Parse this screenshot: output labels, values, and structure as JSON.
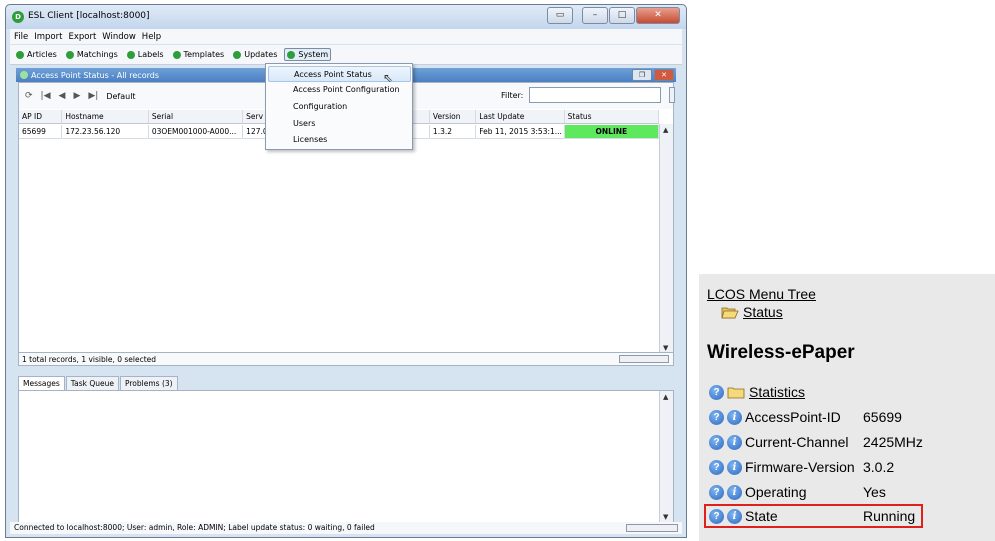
{
  "window": {
    "title": "ESL Client [localhost:8000]"
  },
  "menubar": [
    "File",
    "Import",
    "Export",
    "Window",
    "Help"
  ],
  "toolbar": {
    "items": [
      "Articles",
      "Matchings",
      "Labels",
      "Templates",
      "Updates",
      "System"
    ]
  },
  "inner_frame": {
    "title": "Access Point Status - All records"
  },
  "panel_toolbar": {
    "default_label": "Default",
    "filter_label": "Filter:",
    "filter_value": ""
  },
  "table": {
    "headers": [
      "AP ID",
      "Hostname",
      "Serial",
      "Serv",
      "o...",
      "Version",
      "Last Update",
      "Status"
    ],
    "rows": [
      [
        "65699",
        "172.23.56.120",
        "03OEM001000-A000...",
        "127.0",
        "",
        "1.3.2",
        "Feb 11, 2015 3:53:1...",
        "ONLINE"
      ]
    ]
  },
  "panel_status": "1 total records, 1 visible, 0 selected",
  "dropdown": {
    "items": [
      "Access Point Status",
      "Access Point Configuration",
      "Configuration",
      "Users",
      "Licenses"
    ]
  },
  "bottom_tabs": [
    "Messages",
    "Task Queue",
    "Problems (3)"
  ],
  "statusbar": "Connected to localhost:8000; User: admin, Role: ADMIN; Label update status: 0 waiting, 0 failed",
  "lcos": {
    "menu_tree": "LCOS Menu Tree",
    "status_link": "Status",
    "title": "Wireless-ePaper",
    "statistics": "Statistics",
    "rows": [
      {
        "name": "AccessPoint-ID",
        "value": "65699"
      },
      {
        "name": "Current-Channel",
        "value": "2425MHz"
      },
      {
        "name": "Firmware-Version",
        "value": "3.0.2"
      },
      {
        "name": "Operating",
        "value": "Yes"
      },
      {
        "name": "State",
        "value": "Running"
      }
    ]
  },
  "colors": {
    "online": "#5ee85e",
    "highlight_border": "#e0201a",
    "dot": "#2d9e3b"
  }
}
